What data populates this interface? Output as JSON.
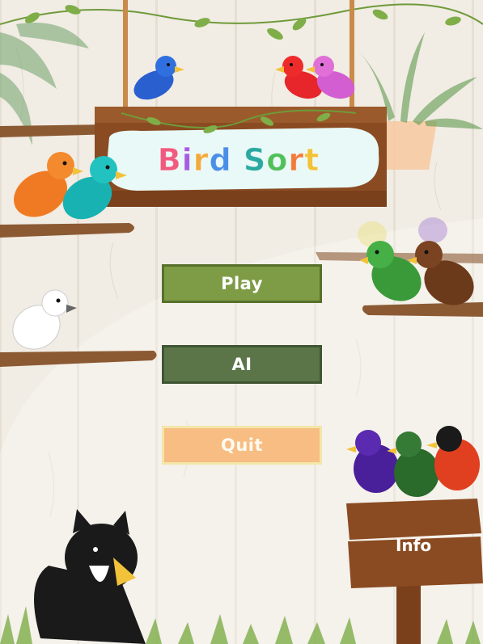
{
  "game": {
    "title_letters": [
      "B",
      "i",
      "r",
      "d",
      " ",
      "S",
      "o",
      "r",
      "t"
    ],
    "title_colors": [
      "#f05a7e",
      "#a55de0",
      "#f2a93b",
      "#4a8fe6",
      "",
      "#2aa9a0",
      "#4fbf5a",
      "#f27a3b",
      "#f2c23b"
    ]
  },
  "menu": {
    "play_label": "Play",
    "ai_label": "AI",
    "quit_label": "Quit"
  },
  "sign": {
    "info_label": "Info"
  },
  "colors": {
    "wood": "#8a4b22",
    "play": "#7e9c45",
    "ai": "#5b7548",
    "quit": "#f7bd82"
  }
}
